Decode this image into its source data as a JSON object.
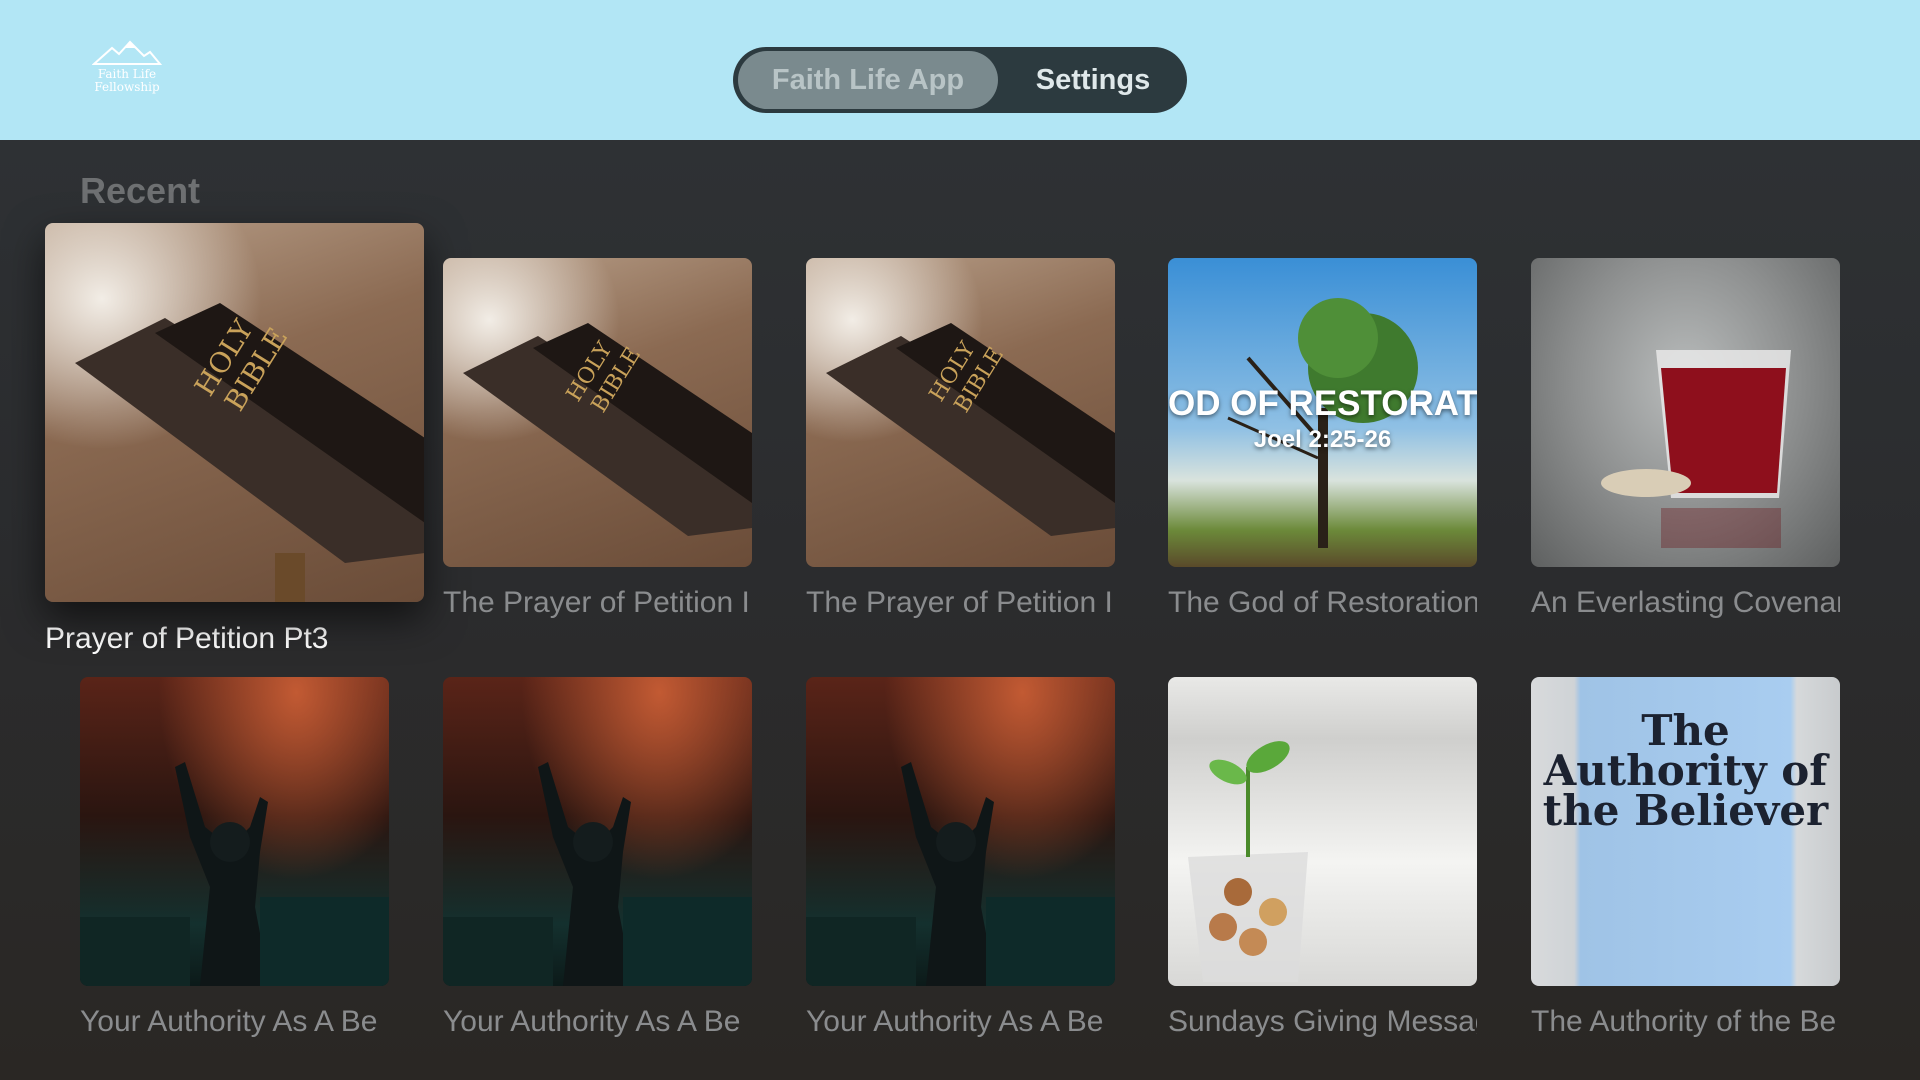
{
  "header": {
    "logo_text": "Faith Life Fellowship",
    "tabs": [
      {
        "label": "Faith Life App",
        "active": true
      },
      {
        "label": "Settings",
        "active": false
      }
    ]
  },
  "section": {
    "title": "Recent"
  },
  "items": [
    {
      "title": "Prayer of Petition Pt3",
      "art": "bible-on-lectern",
      "focused": true
    },
    {
      "title": "The Prayer of Petition I",
      "art": "bible-on-lectern"
    },
    {
      "title": "The Prayer of Petition I",
      "art": "bible-on-lectern"
    },
    {
      "title": "The God of Restoration",
      "art": "tree-sky",
      "overlay": "OD OF RESTORATI",
      "overlay_sub": "Joel 2:25-26"
    },
    {
      "title": "An Everlasting Covenant",
      "art": "communion-cup"
    },
    {
      "title": "Your Authority As A Be",
      "art": "worship-crowd"
    },
    {
      "title": "Your Authority As A Be",
      "art": "worship-crowd"
    },
    {
      "title": "Your Authority As A Be",
      "art": "worship-crowd"
    },
    {
      "title": "Sundays Giving Message",
      "art": "plant-in-coins"
    },
    {
      "title": "The Authority of the Be",
      "art": "book-cover",
      "overlay": "The Authority of the Believer"
    }
  ],
  "colors": {
    "header_bg": "#b2e6f5",
    "page_bg": "#2a2c2f",
    "tab_pill": "#2c3a3f",
    "tab_active": "#7a8a8e"
  }
}
